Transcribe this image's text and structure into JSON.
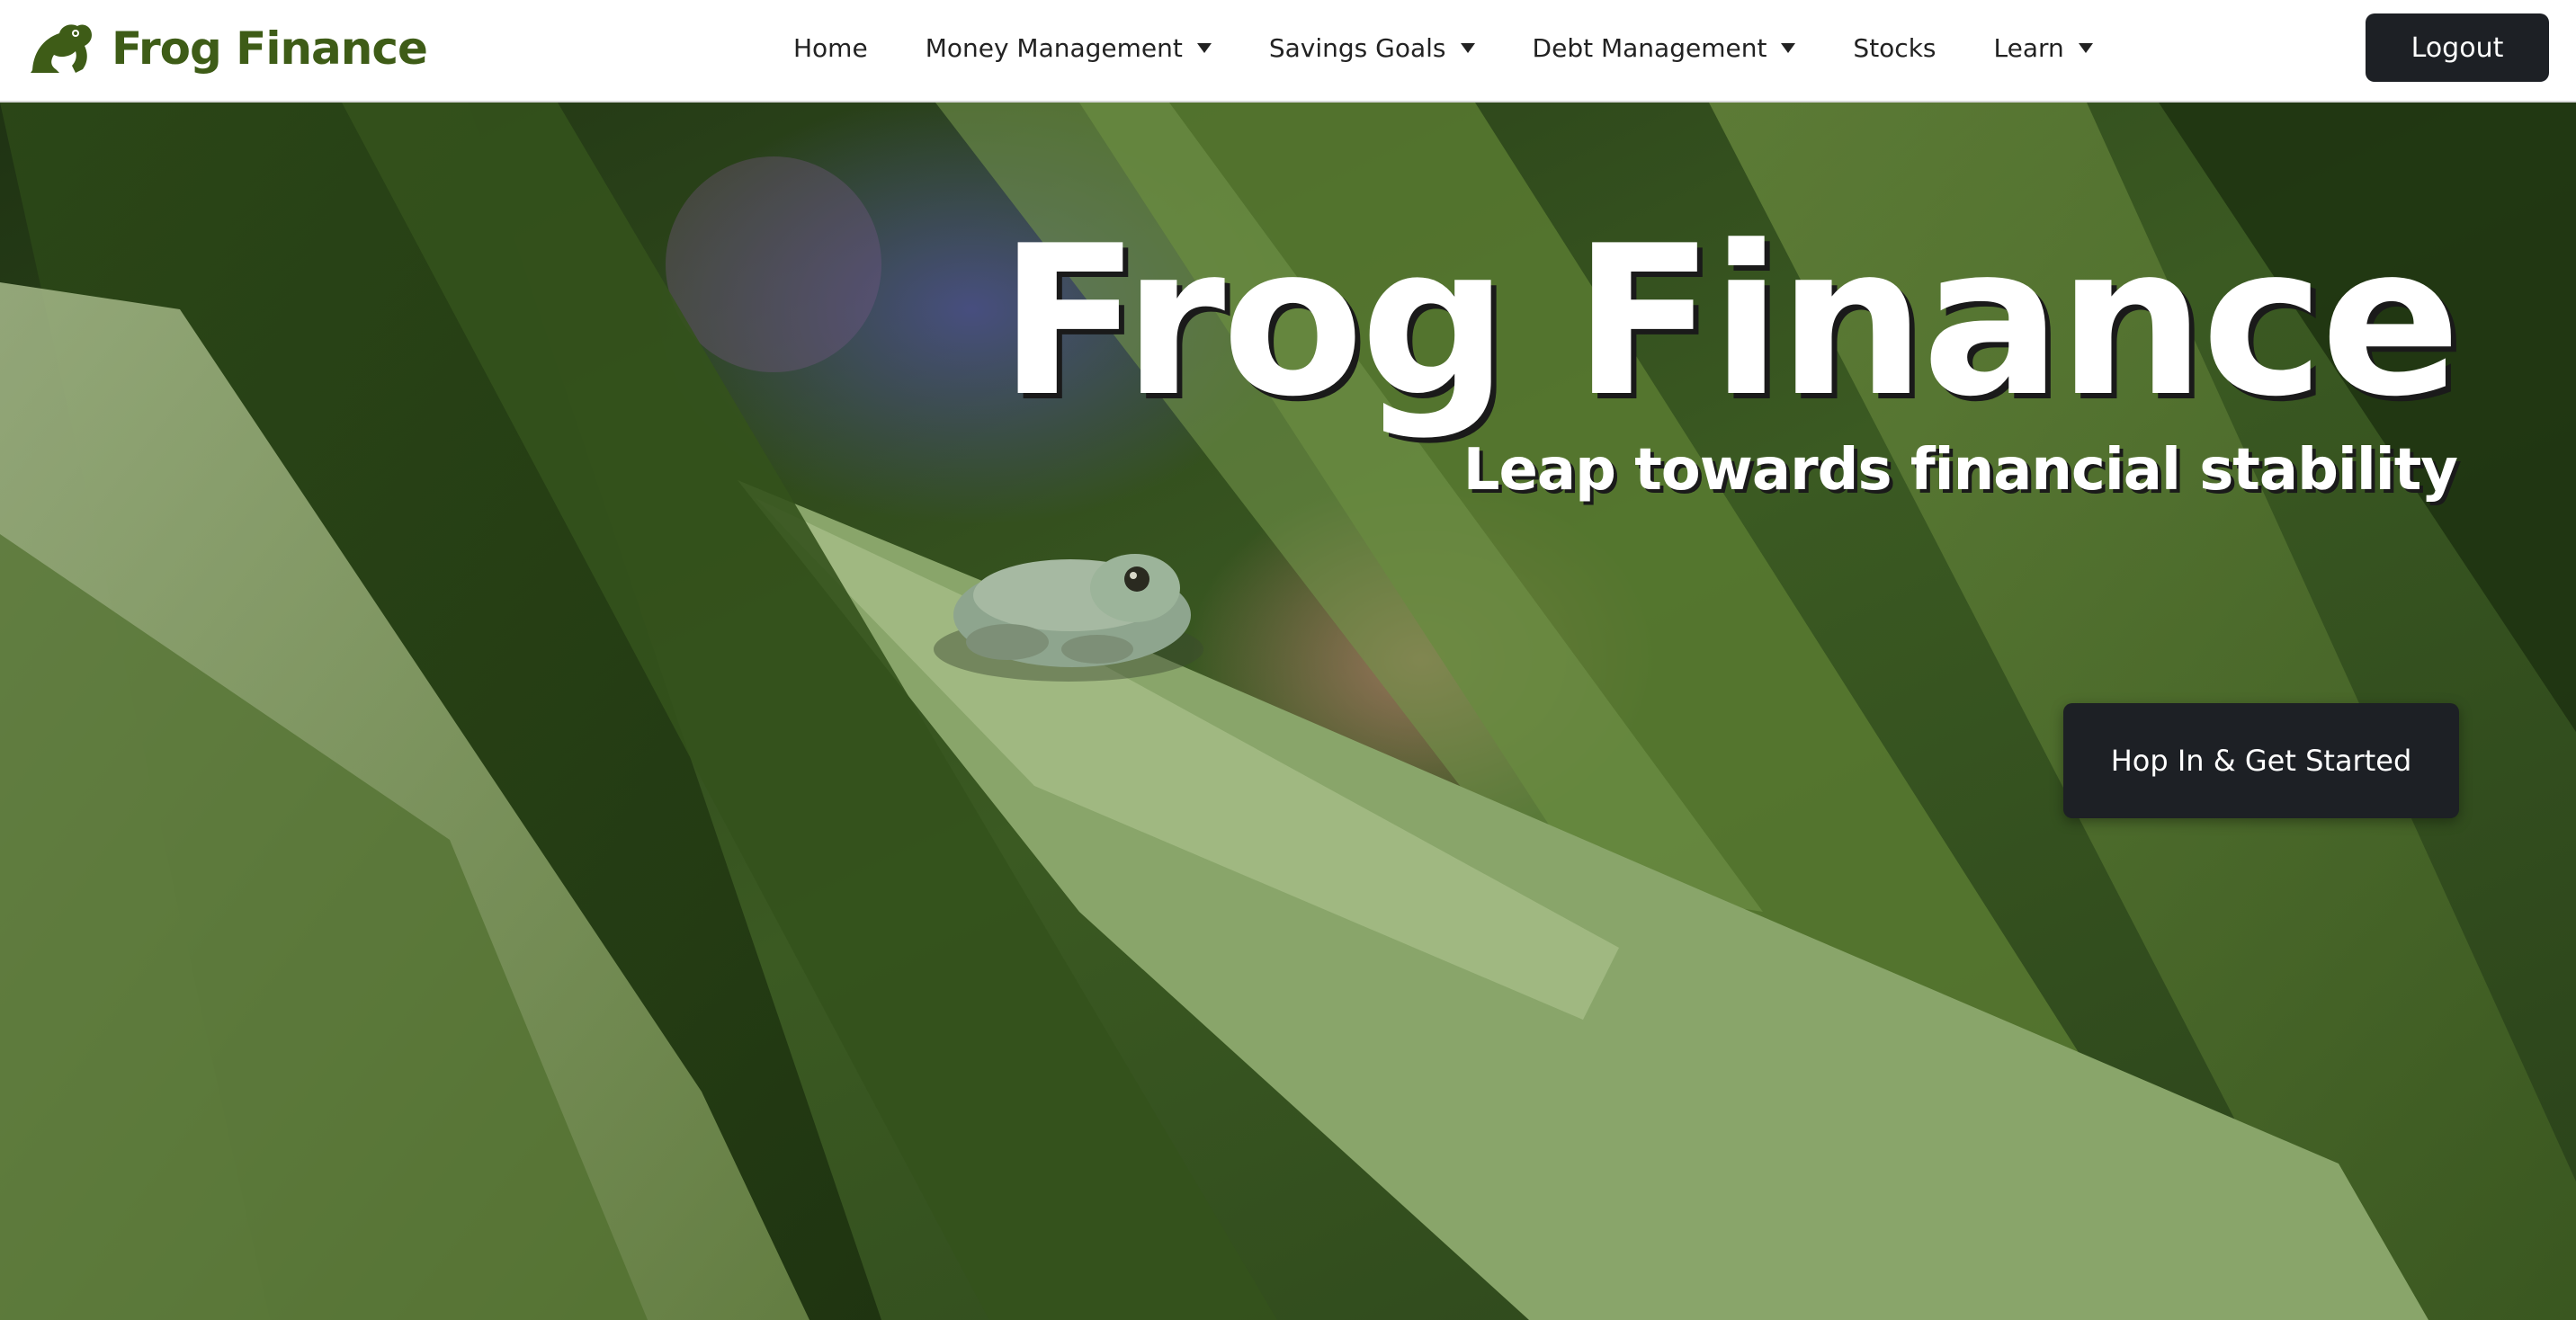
{
  "brand": {
    "name": "Frog Finance",
    "logo_icon": "frog-icon",
    "color": "#3e5c17"
  },
  "nav": {
    "items": [
      {
        "label": "Home",
        "has_dropdown": false
      },
      {
        "label": "Money Management",
        "has_dropdown": true
      },
      {
        "label": "Savings Goals",
        "has_dropdown": true
      },
      {
        "label": "Debt Management",
        "has_dropdown": true
      },
      {
        "label": "Stocks",
        "has_dropdown": false
      },
      {
        "label": "Learn",
        "has_dropdown": true
      }
    ],
    "dropdown_icon": "caret-down-icon",
    "logout_label": "Logout"
  },
  "hero": {
    "title": "Frog Finance",
    "subtitle": "Leap towards financial stability",
    "cta_label": "Hop In & Get Started",
    "background": "frog-on-leaf-photo"
  },
  "colors": {
    "button_bg": "#1d2025",
    "button_text": "#ffffff",
    "nav_text": "#222222"
  }
}
